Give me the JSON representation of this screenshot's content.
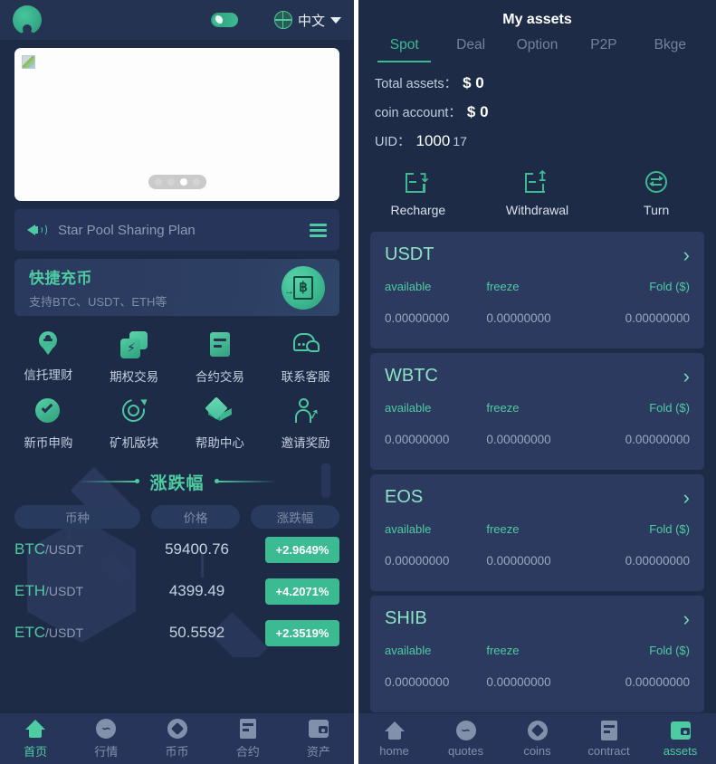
{
  "left": {
    "topbar": {
      "avatar_icon": "avatar-icon",
      "dark_mode_toggle_icon": "moon-toggle-icon",
      "globe_icon": "globe-icon",
      "language": "中文",
      "caret_icon": "chevron-down-icon"
    },
    "carousel": {
      "broken_image_icon": "broken-image-icon",
      "dots": 4,
      "active_dot": 3
    },
    "announcement": {
      "speaker_icon": "speaker-icon",
      "text": "Star Pool Sharing Plan",
      "menu_icon": "hamburger-icon"
    },
    "recharge_card": {
      "title": "快捷充币",
      "subtitle": "支持BTC、USDT、ETH等",
      "icon": "bitcoin-document-icon"
    },
    "grid": [
      {
        "label": "信托理财",
        "icon": "trust-finance-icon"
      },
      {
        "label": "期权交易",
        "icon": "option-trade-icon"
      },
      {
        "label": "合约交易",
        "icon": "contract-trade-icon"
      },
      {
        "label": "联系客服",
        "icon": "customer-service-chat-icon"
      },
      {
        "label": "新币申购",
        "icon": "new-coin-check-icon"
      },
      {
        "label": "矿机版块",
        "icon": "mining-machine-icon"
      },
      {
        "label": "帮助中心",
        "icon": "help-cube-icon"
      },
      {
        "label": "邀请奖励",
        "icon": "invite-person-icon"
      }
    ],
    "market": {
      "title": "涨跌幅",
      "columns": [
        "币种",
        "价格",
        "涨跌幅"
      ],
      "rows": [
        {
          "base": "BTC",
          "quote": "/USDT",
          "price": "59400.76",
          "change": "+2.9649%"
        },
        {
          "base": "ETH",
          "quote": "/USDT",
          "price": "4399.49",
          "change": "+4.2071%"
        },
        {
          "base": "ETC",
          "quote": "/USDT",
          "price": "50.5592",
          "change": "+2.3519%"
        }
      ]
    },
    "bottom_nav": [
      {
        "label": "首页",
        "icon": "home-icon",
        "active": true
      },
      {
        "label": "行情",
        "icon": "quotes-icon",
        "active": false
      },
      {
        "label": "币币",
        "icon": "coins-icon",
        "active": false
      },
      {
        "label": "合约",
        "icon": "contract-icon",
        "active": false
      },
      {
        "label": "资产",
        "icon": "assets-wallet-icon",
        "active": false
      }
    ]
  },
  "right": {
    "title": "My assets",
    "tabs": [
      {
        "label": "Spot",
        "active": true
      },
      {
        "label": "Deal",
        "active": false
      },
      {
        "label": "Option",
        "active": false
      },
      {
        "label": "P2P",
        "active": false
      },
      {
        "label": "Bkge",
        "active": false
      }
    ],
    "stats": {
      "total_assets_label": "Total assets：",
      "total_assets_value": "$ 0",
      "coin_account_label": "coin account：",
      "coin_account_value": "$ 0",
      "uid_label": "UID：",
      "uid_value": "1000",
      "uid_suffix": "17"
    },
    "actions": [
      {
        "label": "Recharge",
        "icon": "recharge-icon"
      },
      {
        "label": "Withdrawal",
        "icon": "withdrawal-icon"
      },
      {
        "label": "Turn",
        "icon": "transfer-icon"
      }
    ],
    "asset_column_heads": [
      "available",
      "freeze",
      "Fold ($)"
    ],
    "assets": [
      {
        "name": "USDT",
        "available": "0.00000000",
        "freeze": "0.00000000",
        "fold": "0.00000000"
      },
      {
        "name": "WBTC",
        "available": "0.00000000",
        "freeze": "0.00000000",
        "fold": "0.00000000"
      },
      {
        "name": "EOS",
        "available": "0.00000000",
        "freeze": "0.00000000",
        "fold": "0.00000000"
      },
      {
        "name": "SHIB",
        "available": "0.00000000",
        "freeze": "0.00000000",
        "fold": "0.00000000"
      }
    ],
    "bottom_nav": [
      {
        "label": "home",
        "icon": "home-icon",
        "active": false
      },
      {
        "label": "quotes",
        "icon": "quotes-icon",
        "active": false
      },
      {
        "label": "coins",
        "icon": "coins-icon",
        "active": false
      },
      {
        "label": "contract",
        "icon": "contract-icon",
        "active": false
      },
      {
        "label": "assets",
        "icon": "assets-wallet-icon",
        "active": true
      }
    ]
  },
  "colors": {
    "background": "#1e2b47",
    "panel_surface": "#27355a",
    "card": "#2b3a5e",
    "accent_green": "#4fcba1",
    "badge_green": "#3cba92",
    "text_primary": "#c6d0de",
    "text_muted": "#8190ab"
  }
}
